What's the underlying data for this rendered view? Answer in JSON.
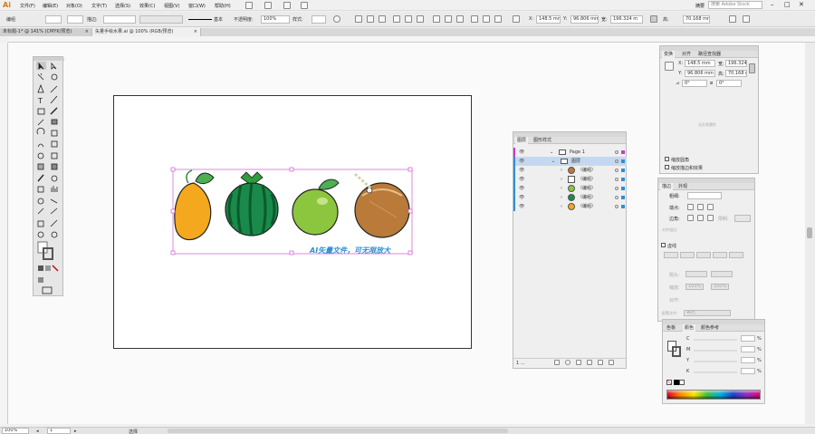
{
  "app": {
    "logo": "Ai"
  },
  "menu": [
    "文件(F)",
    "编辑(E)",
    "对象(O)",
    "文字(T)",
    "选择(S)",
    "效果(C)",
    "视图(V)",
    "窗口(W)",
    "帮助(H)"
  ],
  "topbar": {
    "workspace": "摘要",
    "search_placeholder": "搜索 Adobe Stock"
  },
  "control": {
    "selection_label": "编组",
    "stroke_label": "描边:",
    "brush_label": "基本",
    "opacity_label": "不透明度:",
    "opacity_value": "100%",
    "style_label": "样式:",
    "x_label": "X:",
    "x_value": "148.5 mm",
    "y_label": "Y:",
    "y_value": "96.806 mm",
    "w_label": "宽:",
    "w_value": "196.324 m",
    "h_label": "高:",
    "h_value": "70.168 mm"
  },
  "doc_tabs": [
    {
      "label": "未标题-1* @ 141% (CMYK/预览)",
      "close": "×"
    },
    {
      "label": "矢量手绘水果.ai @ 100% (RGB/预览)",
      "close": "×"
    }
  ],
  "artwork": {
    "watermark": "AI矢量文件，可无限放大"
  },
  "layers_panel": {
    "tabs": [
      "图层",
      "图形样式"
    ],
    "rows": [
      {
        "name": "Page 1"
      },
      {
        "name": "图层"
      },
      {
        "name": "〈编组〉"
      },
      {
        "name": "〈编组〉"
      },
      {
        "name": "〈编组〉"
      },
      {
        "name": "〈编组〉"
      },
      {
        "name": "〈编组〉"
      }
    ],
    "footer": "1 ..."
  },
  "transform_panel": {
    "tabs": [
      "变换",
      "对齐",
      "路径查找器"
    ],
    "x_label": "X:",
    "x_value": "148.5 mm",
    "y_label": "Y:",
    "y_value": "96.806 mm",
    "w_label": "宽:",
    "w_value": "196.324",
    "h_label": "高:",
    "h_value": "70.168 mm",
    "angle_value": "0°",
    "shear_value": "0°",
    "shape_placeholder": "无形状属性",
    "option1": "缩放圆角",
    "option2": "缩放描边和效果"
  },
  "stroke_panel": {
    "tabs": [
      "描边",
      "外观"
    ],
    "weight_label": "粗细:",
    "cap_label": "端点:",
    "corner_label": "边角:",
    "limit_label": "限制:",
    "align_label": "对齐描边:",
    "dashed_label": "虚线",
    "arrow_label": "箭头:",
    "scale_label": "缩放:",
    "scale_value1": "100%",
    "scale_value2": "100%",
    "align2_label": "对齐:",
    "profile_label": "配置文件:",
    "profile_value": "等比"
  },
  "color_panel": {
    "tabs": [
      "色板",
      "颜色",
      "颜色参考"
    ],
    "channels": [
      "C",
      "M",
      "Y",
      "K"
    ],
    "unit": "%"
  },
  "status": {
    "zoom": "100%",
    "page": "1",
    "tool": "选择"
  },
  "colors": {
    "accent": "#2d8fd5",
    "mango": "#f4a81d",
    "watermelon": "#1a8a4a",
    "lime": "#8cc63f",
    "coconut": "#b97a3a",
    "selection": "#c83cc8"
  }
}
